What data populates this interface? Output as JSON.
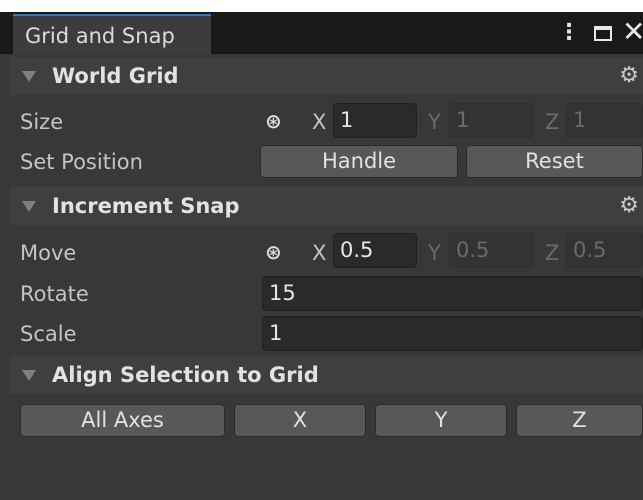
{
  "window": {
    "tab_title": "Grid and Snap",
    "menu_icon": "kebab-menu-icon",
    "maximize_icon": "maximize-icon",
    "close_icon": "close-icon"
  },
  "world_grid": {
    "title": "World Grid",
    "size": {
      "label": "Size",
      "x_label": "X",
      "x_value": "1",
      "y_label": "Y",
      "y_value": "1",
      "z_label": "Z",
      "z_value": "1"
    },
    "set_position": {
      "label": "Set Position",
      "handle_label": "Handle",
      "reset_label": "Reset"
    }
  },
  "increment_snap": {
    "title": "Increment Snap",
    "move": {
      "label": "Move",
      "x_label": "X",
      "x_value": "0.5",
      "y_label": "Y",
      "y_value": "0.5",
      "z_label": "Z",
      "z_value": "0.5"
    },
    "rotate": {
      "label": "Rotate",
      "value": "15"
    },
    "scale": {
      "label": "Scale",
      "value": "1"
    }
  },
  "align": {
    "title": "Align Selection to Grid",
    "buttons": [
      "All Axes",
      "X",
      "Y",
      "Z"
    ]
  },
  "colors": {
    "accent": "#3a79bb",
    "panel": "#383838",
    "header": "#3f3f3f",
    "button": "#585858"
  }
}
